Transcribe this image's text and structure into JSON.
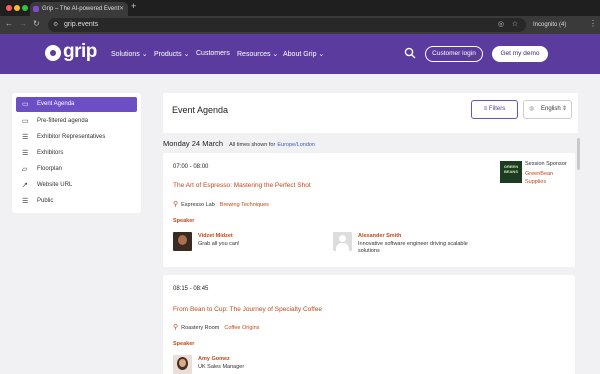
{
  "browser": {
    "tab_title": "Grip – The AI-powered Event",
    "url": "grip.events",
    "incognito_label": "Incognito (4)"
  },
  "colors": {
    "brand": "#5b3c9e",
    "accent": "#6c4fc4",
    "link": "#c4481a"
  },
  "header": {
    "logo": "grip",
    "nav": [
      "Solutions",
      "Products",
      "Customers",
      "Resources",
      "About Grip"
    ],
    "login_label": "Customer login",
    "demo_label": "Get my demo"
  },
  "sidebar": {
    "items": [
      {
        "label": "Event Agenda",
        "icon": "calendar-icon",
        "active": true
      },
      {
        "label": "Pre-filtered agenda",
        "icon": "calendar-icon"
      },
      {
        "label": "Exhibitor Representatives",
        "icon": "list-icon"
      },
      {
        "label": "Exhibitors",
        "icon": "list-icon"
      },
      {
        "label": "Floorplan",
        "icon": "map-icon"
      },
      {
        "label": "Website URL",
        "icon": "external-link-icon"
      },
      {
        "label": "Public",
        "icon": "list-icon"
      }
    ]
  },
  "main": {
    "title": "Event Agenda",
    "filters_label": "Filters",
    "language": "English",
    "day": "Monday 24 March",
    "tz_prefix": "All times shown for",
    "tz": "Europe/London"
  },
  "sessions": [
    {
      "time": "07:00 - 08:00",
      "title": "The Art of Espresso: Mastering the Perfect Shot",
      "location": "Espresso Lab",
      "tag": "Brewing Techniques",
      "speaker_label": "Speaker",
      "speakers": [
        {
          "name": "Vidzet Midzet",
          "desc": "Grab all you can!"
        },
        {
          "name": "Alexander Smith",
          "desc": "Innovative software engineer driving scalable solutions"
        }
      ],
      "sponsor_label": "Session Sponsor",
      "sponsor_name": "GreenBean Supplies",
      "sponsor_logo_text": "GREEN BEANS"
    },
    {
      "time": "08:15 - 08:45",
      "title": "From Bean to Cup: The Journey of Specialty Coffee",
      "location": "Roastery Room",
      "tag": "Coffee Origins",
      "speaker_label": "Speaker",
      "speakers": [
        {
          "name": "Amy Gomez",
          "desc": "UK Sales Manager"
        }
      ]
    }
  ]
}
